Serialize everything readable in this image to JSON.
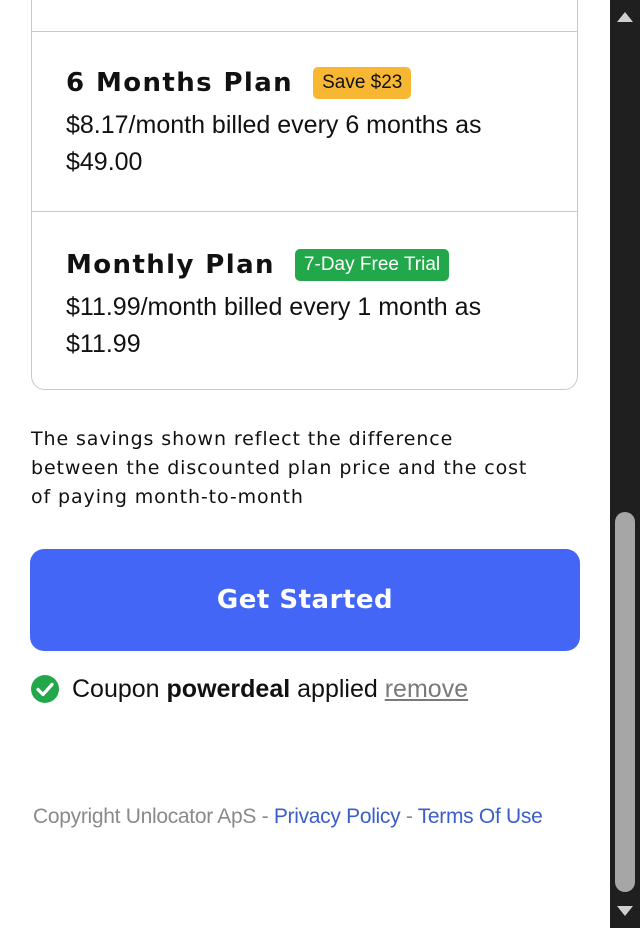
{
  "plans": [
    {
      "title": "6 Months Plan",
      "badge": "Save $23",
      "badge_color": "#f7b733",
      "desc_line1": "$8.17/month billed every 6 months as",
      "desc_line2": "$49.00"
    },
    {
      "title": "Monthly Plan",
      "badge": "7-Day Free Trial",
      "badge_color": "#22a84a",
      "desc_line1": "$11.99/month billed every 1 month as",
      "desc_line2": "$11.99"
    }
  ],
  "savings_note": {
    "line1": "The savings shown reflect the difference",
    "line2": "between the discounted plan price and the cost",
    "line3": "of paying month-to-month"
  },
  "cta": {
    "label": "Get Started",
    "color": "#4466f7"
  },
  "coupon": {
    "prefix": "Coupon",
    "code": "powerdeal",
    "suffix": "applied",
    "remove_label": "remove",
    "icon": "check-circle-icon",
    "icon_color": "#22a84a"
  },
  "footer": {
    "copyright": "Copyright Unlocator ApS",
    "separator1": " - ",
    "privacy_label": "Privacy Policy",
    "separator2": " - ",
    "terms_label": "Terms Of Use"
  }
}
